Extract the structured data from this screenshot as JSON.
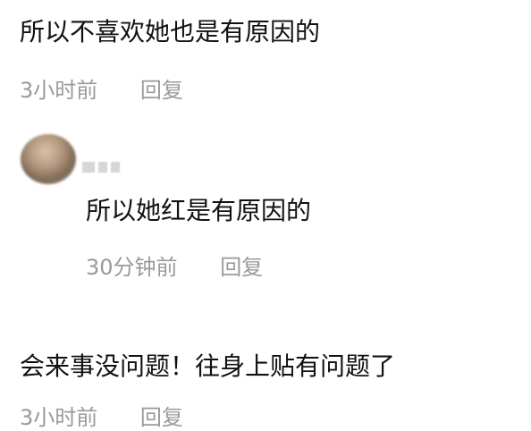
{
  "comments": [
    {
      "text": "所以不喜欢她也是有原因的",
      "time": "3小时前",
      "reply_label": "回复"
    },
    {
      "text": "所以她红是有原因的",
      "time": "30分钟前",
      "reply_label": "回复"
    },
    {
      "text": "会来事没问题！往身上贴有问题了",
      "time": "3小时前",
      "reply_label": "回复"
    }
  ]
}
